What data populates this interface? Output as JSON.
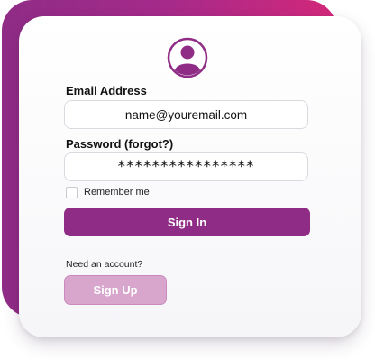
{
  "form": {
    "email_label": "Email Address",
    "email_value": "name@youremail.com",
    "password_label": "Password (forgot?)",
    "password_value": "****************",
    "remember_label": "Remember me",
    "remember_checked": false,
    "signin_label": "Sign In",
    "need_account_text": "Need an account?",
    "signup_label": "Sign Up"
  },
  "icons": {
    "avatar": "user-avatar-icon"
  },
  "colors": {
    "brand": "#8f2c86",
    "brand_light": "#d8a6cd",
    "gradient_end": "#d3287a"
  }
}
